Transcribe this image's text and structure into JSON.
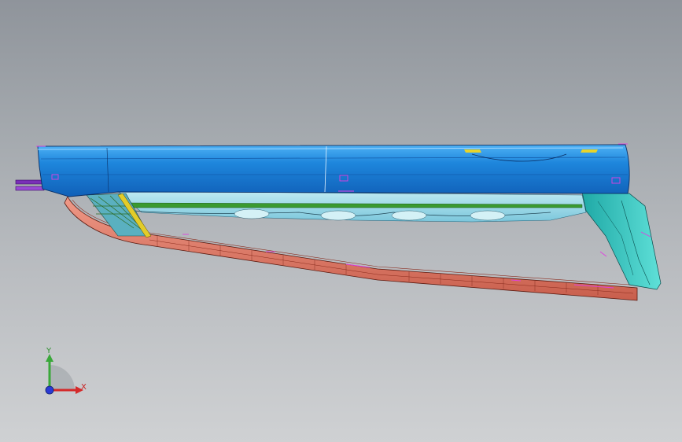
{
  "viewport": {
    "background_top": "#8f949b",
    "background_bottom": "#cfd1d3"
  },
  "model": {
    "body_color": "#1e7fd6",
    "body_highlight": "#3aa0f0",
    "interior_color": "#8fd3e6",
    "inner_strip_color": "#2f8a2a",
    "support_color": "#2ec9c0",
    "lower_shell_color": "#e07a68",
    "marker_color": "#e040e0",
    "edge_color": "#0a2f66"
  },
  "triad": {
    "x_label": "X",
    "y_label": "Y",
    "x_color": "#d42a2a",
    "y_color": "#3aa83a",
    "z_color": "#2a3ad4"
  }
}
